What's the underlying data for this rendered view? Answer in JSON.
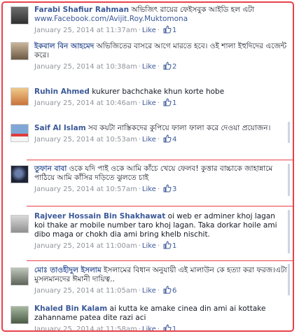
{
  "comments": [
    {
      "name": "Farabi Shafiur Rahman",
      "text": "অভিজিৎ রায়ের ফেইসবুক আইডি হল এটা",
      "link": "www.Facebook.com/Avijit.Roy.Muktomona",
      "time": "January 25, 2014 at 11:37am",
      "like": "Like",
      "likes": "1"
    },
    {
      "name": "ইকবাল বিন আহমেদ",
      "text": "অভিজিতের বাসরে আগে মারতে হবে। ওই শালা ইহুদিদের এজেন্ট করে।",
      "time": "January 25, 2014 at 10:38am",
      "like": "Like",
      "likes": "2"
    },
    {
      "name": "Ruhin Ahmed",
      "text": "kukurer bachchake khun korte hobe",
      "time": "January 25, 2014 at 10:46am",
      "like": "Like",
      "likes": "1"
    },
    {
      "name": "Saif Al Islam",
      "text": "সব কয়টা নাস্তিকদের কুপিয়ে ফালা ফালা করে দেওয়া প্রয়োজন।",
      "time": "January 25, 2014 at 10:53am",
      "like": "Like",
      "likes": "4"
    },
    {
      "name": "তুফান বাবা",
      "text": "ওকে যদি পাই ওকে আমি কাঁচে খেয়ে ফেলব! কুত্তার বাচ্চাকে জাহান্নামে পাঠিয়ে আমি কাঁসির দড়িতে ঝুলতে চাই",
      "time": "January 25, 2014 at 10:57am",
      "like": "Like",
      "likes": "3"
    },
    {
      "name": "Rajveer Hossain Bin Shakhawat",
      "text": "oi web er adminer khoj lagan koi thake ar mobile number taro khoj lagan. Taka dorkar hoile ami dibo maga or chokh dia ami bring khelb nischit.",
      "time": "January 25, 2014 at 11:00am",
      "like": "Like",
      "likes": "1"
    },
    {
      "name": "মোঃ তাওহীদুল ইসলাম",
      "text": "ইসলামের বিধান অনুযায়ী এই মালাউন কে হত্যা করা ফরজ।এটা মুসলমানদের ঈমানী দায়িত্ব..",
      "time": "January 25, 2014 at 11:05am",
      "like": "Like",
      "likes": "6"
    },
    {
      "name": "Khaled Bin Kalam",
      "text": "ai kutta ke amake cinea din ami ai kottake zahanname patea dite razi aci",
      "time": "January 25, 2014 at 11:58am",
      "like": "Like",
      "likes": "1"
    }
  ],
  "colors": {
    "frame": "#e8424b",
    "name": "#3b5998",
    "meta": "#90949c"
  }
}
